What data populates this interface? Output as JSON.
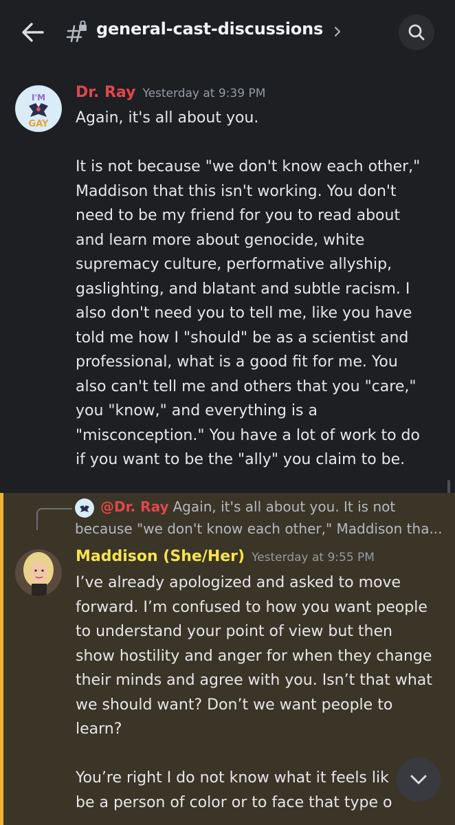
{
  "header": {
    "channel_name": "general-cast-discussions",
    "icons": {
      "back": "arrow-left-icon",
      "channel": "hash-lock-icon",
      "chevron": "chevron-right-icon",
      "search": "search-icon"
    }
  },
  "messages": [
    {
      "author": "Dr. Ray",
      "author_color": "#e0474c",
      "timestamp": "Yesterday at 9:39 PM",
      "avatar_text": "I'M GAY",
      "lines_p1": [
        "Again, it's all about you."
      ],
      "lines_p2": [
        "It is not because \"we don't know each other,\"",
        "Maddison that this isn't working. You don't",
        "need to be my friend for you to read about",
        "and learn more about genocide, white",
        "supremacy culture, performative allyship,",
        "gaslighting, and blatant and subtle racism. I",
        "also don't need you to tell me, like you have",
        "told me how I \"should\" be as a scientist and",
        "professional, what is a good fit for me. You",
        "also can't tell me and others that you \"care,\"",
        "you \"know,\" and everything is a",
        "\"misconception.\" You have a lot of work to do",
        "if you want to be the \"ally\" you claim to be."
      ]
    },
    {
      "author": "Maddison (She/Her)",
      "author_color": "#f7e34b",
      "timestamp": "Yesterday at 9:55 PM",
      "highlight_color": "#f0b232",
      "reply": {
        "mention": "@Dr. Ray",
        "preview_line1": "Again, it's all about you.  It is not",
        "preview_line2": "because \"we don't know each other,\" Maddison tha..."
      },
      "lines_p1": [
        "I’ve already apologized and asked to move",
        "forward. I’m confused to how you want people",
        "to understand your point of view but then",
        "show hostility and anger for when they change",
        "their minds and agree with you. Isn’t that what",
        "we should want? Don’t we want people to",
        "learn?"
      ],
      "lines_p2": [
        "You’re right I do not know what it feels lik",
        "be a person of color or to face that type o"
      ]
    }
  ],
  "jump_button": {
    "icon": "chevron-down-icon"
  }
}
